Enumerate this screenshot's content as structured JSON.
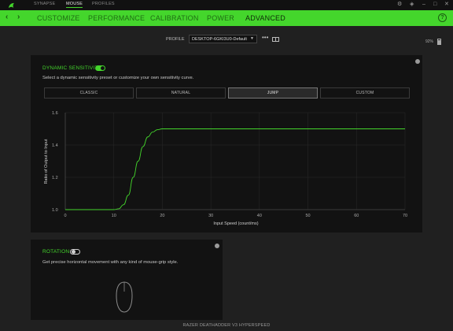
{
  "titlebar": {
    "tabs": [
      {
        "label": "SYNAPSE",
        "active": false
      },
      {
        "label": "MOUSE",
        "active": true
      },
      {
        "label": "PROFILES",
        "active": false
      }
    ],
    "icons": [
      "razer-logo-icon",
      "settings-icon",
      "notification-icon",
      "minimize-icon",
      "maximize-icon",
      "close-icon"
    ]
  },
  "nav": {
    "tabs": [
      {
        "label": "CUSTOMIZE",
        "active": false
      },
      {
        "label": "PERFORMANCE",
        "active": false
      },
      {
        "label": "CALIBRATION",
        "active": false
      },
      {
        "label": "POWER",
        "active": false
      },
      {
        "label": "ADVANCED",
        "active": true
      }
    ],
    "help": "?"
  },
  "profile": {
    "label": "PROFILE",
    "value": "DESKTOP-6GKI3U0-Default",
    "more": "•••"
  },
  "battery": {
    "text": "92%"
  },
  "dynamic_sensitivity": {
    "title": "DYNAMIC SENSITIVITY",
    "enabled": true,
    "description": "Select a dynamic sensitivity preset or customize your own sensitivity curve.",
    "presets": [
      {
        "label": "CLASSIC",
        "active": false
      },
      {
        "label": "NATURAL",
        "active": false
      },
      {
        "label": "JUMP",
        "active": true
      },
      {
        "label": "CUSTOM",
        "active": false
      }
    ]
  },
  "chart_data": {
    "type": "line",
    "xlabel": "Input Speed (count/ms)",
    "ylabel": "Ratio of Output to Input",
    "xlim": [
      0,
      70
    ],
    "ylim": [
      1.0,
      1.6
    ],
    "xticks": [
      0,
      10,
      20,
      30,
      40,
      50,
      60,
      70
    ],
    "yticks": [
      "1.0",
      "1.2",
      "1.4",
      "1.6"
    ],
    "grid": true,
    "series": [
      {
        "x": [
          0,
          10,
          11,
          12,
          13,
          14,
          15,
          16,
          17,
          18,
          19,
          20,
          70
        ],
        "y": [
          1.0,
          1.0,
          1.005,
          1.03,
          1.09,
          1.2,
          1.3,
          1.39,
          1.45,
          1.48,
          1.495,
          1.5,
          1.5
        ]
      }
    ],
    "colors": {
      "line": "#44d62c",
      "grid": "#2a2a2a",
      "axis": "#555555"
    }
  },
  "rotation": {
    "title": "ROTATION",
    "enabled": false,
    "description": "Get precise horizontal movement with any kind of mouse-grip style."
  },
  "footer": {
    "device": "RAZER DEATHADDER V3 HYPERSPEED"
  }
}
